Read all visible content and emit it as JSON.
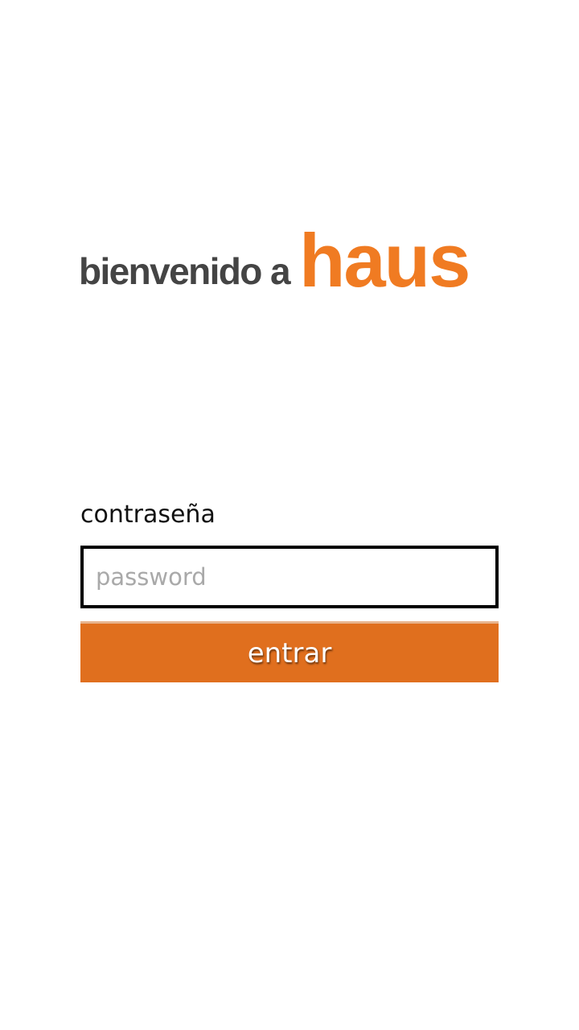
{
  "logo": {
    "prefix": "bienvenido a",
    "brand": "haus",
    "brand_color": "#f07b22",
    "prefix_color": "#444444"
  },
  "login": {
    "password_label": "contraseña",
    "password_placeholder": "password",
    "password_value": "",
    "submit_label": "entrar",
    "submit_color": "#e06f1e"
  }
}
